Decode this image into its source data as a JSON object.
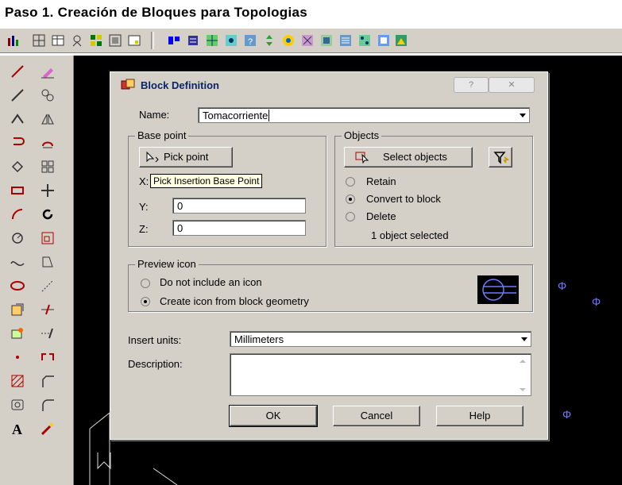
{
  "page_title": "Paso 1. Creación de Bloques para Topologias",
  "dialog": {
    "title": "Block Definition",
    "help_icon": "?",
    "close_icon": "✕",
    "name_label": "Name:",
    "name_value": "Tomacorriente",
    "base_point": {
      "group_title": "Base point",
      "pick_button": "Pick point",
      "tooltip": "Pick Insertion Base Point",
      "x_label": "X:",
      "y_label": "Y:",
      "y_value": "0",
      "z_label": "Z:",
      "z_value": "0"
    },
    "objects": {
      "group_title": "Objects",
      "select_button": "Select objects",
      "options": [
        {
          "label": "Retain",
          "selected": false
        },
        {
          "label": "Convert to block",
          "selected": true
        },
        {
          "label": "Delete",
          "selected": false
        }
      ],
      "status": "1 object selected"
    },
    "preview": {
      "group_title": "Preview icon",
      "options": [
        {
          "label": "Do not include an icon",
          "selected": false
        },
        {
          "label": "Create icon from block geometry",
          "selected": true
        }
      ]
    },
    "insert_units_label": "Insert units:",
    "insert_units_value": "Millimeters",
    "description_label": "Description:",
    "description_value": "",
    "buttons": {
      "ok": "OK",
      "cancel": "Cancel",
      "help": "Help"
    }
  },
  "canvas_symbol": "Φ",
  "colors": {
    "accent": "#0a246a",
    "face": "#d4d0c8",
    "canvas": "#000000",
    "symbol": "#6f79ff"
  }
}
